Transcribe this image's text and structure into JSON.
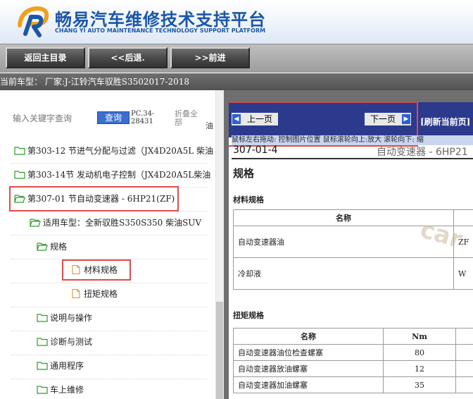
{
  "header": {
    "title": "畅易汽车维修技术支持平台",
    "subtitle": "CHANG YI AUTO MAINTENANCE TECHNOLOGY SUPPORT PLATFORM",
    "brand_color": "#1b56a8"
  },
  "nav": {
    "home_label": "返回主目录",
    "back_label": "<<后退.",
    "forward_label": ">>前进"
  },
  "vehicle_bar": {
    "text": "当前车型：  厂家:J-江铃汽车驭胜S3502017-2018"
  },
  "search": {
    "placeholder": "输入关键字查询",
    "button_label": "查询",
    "pc_label": "PC.34-28431",
    "collapse_label": "折叠全部",
    "partial_text": "油"
  },
  "tree": {
    "items": [
      {
        "label": "第303-12 节进气分配与过滤（JX4D20A5L 柴油",
        "icon": "folder-icon"
      },
      {
        "label": "第303-14节 发动机电子控制（JX4D20A5L柴油",
        "icon": "folder-icon"
      },
      {
        "label": "第307-01 节自动变速器 - 6HP21(ZF)",
        "icon": "folder-open-icon"
      },
      {
        "label": "适用车型：全新驭胜S350S350 柴油SUV",
        "icon": "folder-open-icon"
      },
      {
        "label": "规格",
        "icon": "folder-open-icon"
      },
      {
        "label": "材料规格",
        "icon": "document-icon"
      },
      {
        "label": "扭矩规格",
        "icon": "document-icon"
      },
      {
        "label": "说明与操作",
        "icon": "folder-icon"
      },
      {
        "label": "诊断与测试",
        "icon": "folder-icon"
      },
      {
        "label": "通用程序",
        "icon": "folder-icon"
      },
      {
        "label": "车上维修",
        "icon": "folder-icon"
      }
    ]
  },
  "toolbar": {
    "prev_label": "上一页",
    "next_label": "下一页",
    "refresh_label": "[刷新当前页]",
    "hint": "鼠标左右拖动: 控制图片位置  鼠标滚轮向上:放大  滚轮向下: 缩"
  },
  "document": {
    "code": "307-01-4",
    "model": "自动变速器 - 6HP21",
    "section_title": "规格",
    "material_title": "材料规格",
    "material_header": "名称",
    "material_rows": [
      {
        "name": "自动变速器油",
        "value": "ZF"
      },
      {
        "name": "冷却液",
        "value": "W"
      }
    ],
    "torque_title": "扭矩规格",
    "torque_header_name": "名称",
    "torque_header_nm": "Nm",
    "torque_rows": [
      {
        "name": "自动变速器油位检查螺塞",
        "nm": "80"
      },
      {
        "name": "自动变速器放油螺塞",
        "nm": "12"
      },
      {
        "name": "自动变速器加油螺塞",
        "nm": "35"
      }
    ],
    "watermark": "car"
  }
}
